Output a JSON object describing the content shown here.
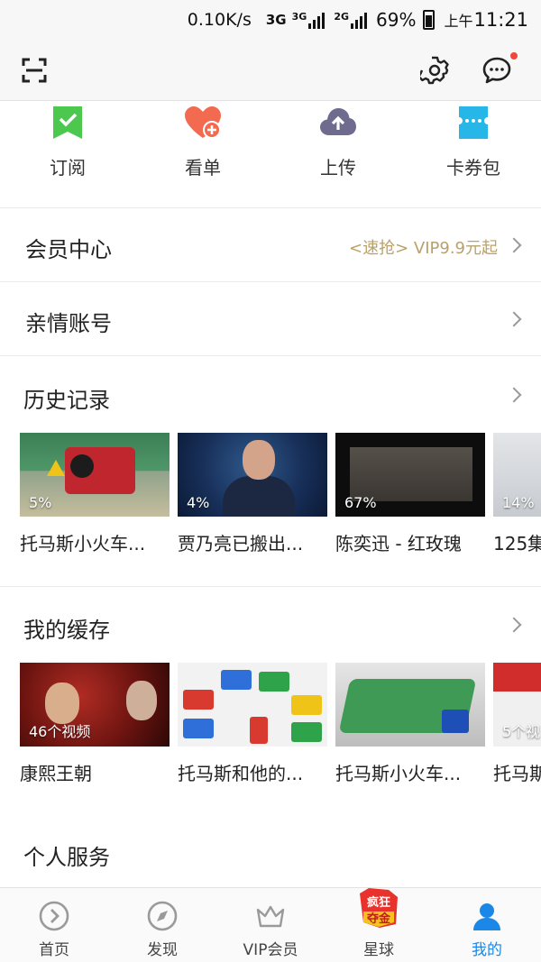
{
  "status_bar": {
    "net_speed": "0.10K/s",
    "sim1": "3G",
    "sim1_sub": "3G",
    "sim2": "2G",
    "battery": "69%",
    "ampm": "上午",
    "time": "11:21"
  },
  "app_bar": {
    "scan_icon": "scan-icon",
    "settings_icon": "gear-icon",
    "message_icon": "message-icon",
    "notification_dot": "#f2453d"
  },
  "quick_actions": [
    {
      "label": "订阅",
      "icon": "subscribe-bookmark-icon",
      "color": "#4cc84f"
    },
    {
      "label": "看单",
      "icon": "watchlist-heart-icon",
      "color": "#f26a4f"
    },
    {
      "label": "上传",
      "icon": "upload-cloud-icon",
      "color": "#6f6b8f"
    },
    {
      "label": "卡券包",
      "icon": "coupon-ticket-icon",
      "color": "#26b6e8"
    }
  ],
  "member_center": {
    "title": "会员中心",
    "promo": "<速抢> VIP9.9元起"
  },
  "family_account": {
    "title": "亲情账号"
  },
  "history": {
    "title": "历史记录",
    "items": [
      {
        "progress": "5%",
        "title": "托马斯小火车..."
      },
      {
        "progress": "4%",
        "title": "贾乃亮已搬出..."
      },
      {
        "progress": "67%",
        "title": "陈奕迅 - 红玫瑰"
      },
      {
        "progress": "14%",
        "title": "125集"
      }
    ]
  },
  "cache": {
    "title": "我的缓存",
    "items": [
      {
        "count": "46个视频",
        "title": "康熙王朝"
      },
      {
        "count": "",
        "title": "托马斯和他的..."
      },
      {
        "count": "",
        "title": "托马斯小火车..."
      },
      {
        "count": "5个视",
        "title": "托马斯"
      }
    ]
  },
  "personal_services": {
    "title": "个人服务"
  },
  "bottom_nav": [
    {
      "label": "首页",
      "icon": "home-play-icon",
      "active": false
    },
    {
      "label": "发现",
      "icon": "compass-icon",
      "active": false
    },
    {
      "label": "VIP会员",
      "icon": "crown-icon",
      "active": false
    },
    {
      "label": "星球",
      "icon": "planet-promo-badge-icon",
      "active": false,
      "badge": "疯狂夺金"
    },
    {
      "label": "我的",
      "icon": "profile-person-icon",
      "active": true
    }
  ],
  "colors": {
    "accent_blue": "#1c87e6",
    "promo_gold": "#b9a16b"
  }
}
